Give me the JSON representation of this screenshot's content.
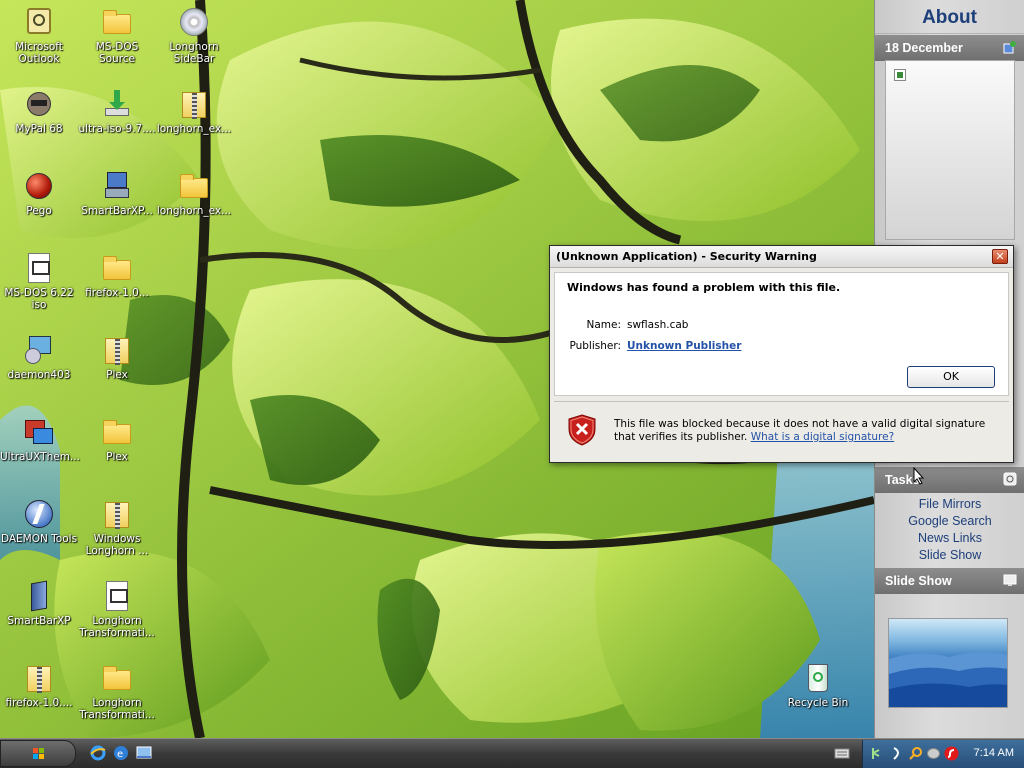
{
  "desktop": {
    "icons": [
      {
        "label": "Microsoft Outlook"
      },
      {
        "label": "MS-DOS Source"
      },
      {
        "label": "Longhorn SideBar"
      },
      {
        "label": "MyPal 68"
      },
      {
        "label": "ultra-iso-9.7...."
      },
      {
        "label": "longhorn_ex..."
      },
      {
        "label": "Pego"
      },
      {
        "label": "SmartBarXP..."
      },
      {
        "label": "longhorn_ex..."
      },
      {
        "label": "MS-DOS 6.22 iso"
      },
      {
        "label": "firefox-1.0..."
      },
      {
        "label": "daemon403"
      },
      {
        "label": "Plex"
      },
      {
        "label": "UltraUXThem..."
      },
      {
        "label": "Plex"
      },
      {
        "label": "DAEMON Tools"
      },
      {
        "label": "Windows Longhorn ..."
      },
      {
        "label": "SmartBarXP"
      },
      {
        "label": "Longhorn Transformati..."
      },
      {
        "label": "firefox-1.0...."
      },
      {
        "label": "Longhorn Transformati..."
      },
      {
        "label": "Recycle Bin"
      }
    ]
  },
  "sidebar": {
    "about_title": "About",
    "calendar_header": "18 December",
    "tasks_header": "Tasks",
    "tasks": [
      "File Mirrors",
      "Google Search",
      "News Links",
      "Slide Show"
    ],
    "slideshow_header": "Slide Show"
  },
  "dialog": {
    "title": "(Unknown Application) - Security Warning",
    "heading": "Windows has found a problem with this file.",
    "name_label": "Name:",
    "name_value": "swflash.cab",
    "publisher_label": "Publisher:",
    "publisher_value": "Unknown Publisher",
    "ok_label": "OK",
    "close_label": "✕",
    "warning_text": "This file was blocked because it does not have a valid digital signature that verifies its publisher.",
    "help_link": "What is a digital signature?"
  },
  "taskbar": {
    "clock": "7:14 AM"
  },
  "colors": {
    "link": "#2452a8",
    "sidebar_title": "#1d3f7a",
    "shield_red": "#c8201c"
  }
}
